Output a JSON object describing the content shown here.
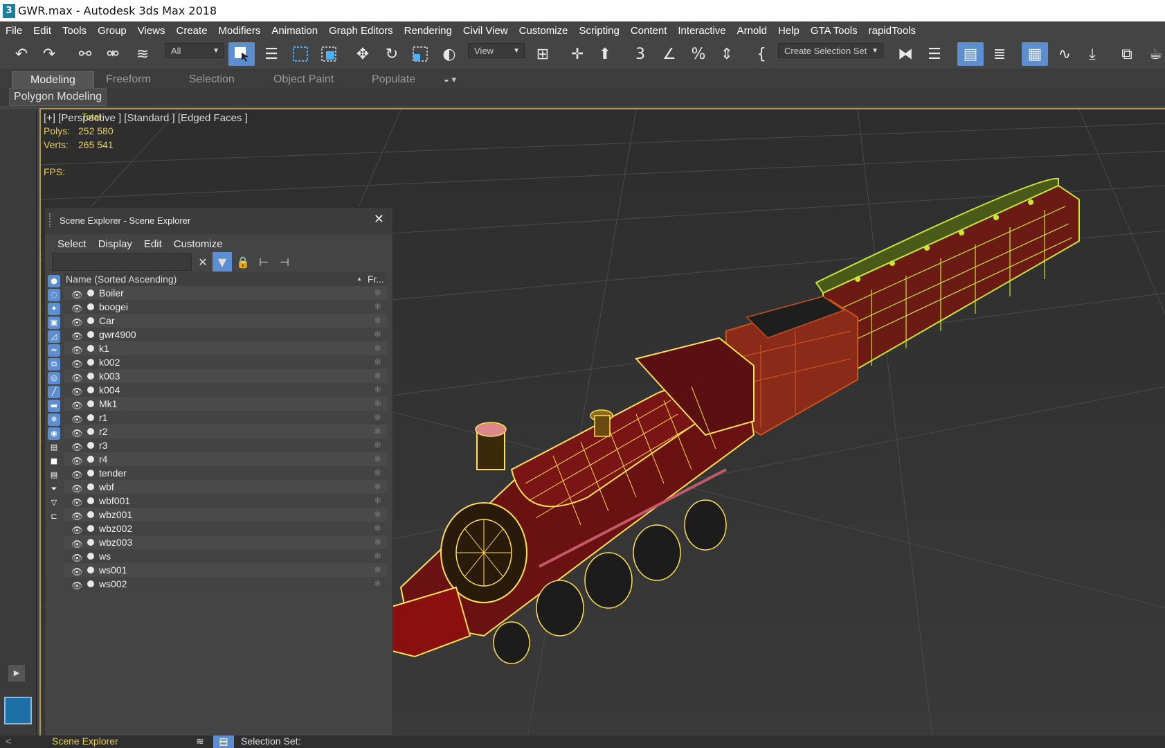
{
  "window": {
    "title": "GWR.max - Autodesk 3ds Max 2018",
    "app_icon": "3"
  },
  "menu": [
    "File",
    "Edit",
    "Tools",
    "Group",
    "Views",
    "Create",
    "Modifiers",
    "Animation",
    "Graph Editors",
    "Rendering",
    "Civil View",
    "Customize",
    "Scripting",
    "Content",
    "Interactive",
    "Arnold",
    "Help",
    "GTA Tools",
    "rapidTools"
  ],
  "toolbar": {
    "filter_value": "All",
    "refcoord_value": "View",
    "selset_value": "Create Selection Set"
  },
  "ribbon": {
    "tabs": [
      "Modeling",
      "Freeform",
      "Selection",
      "Object Paint",
      "Populate"
    ],
    "active": "Modeling",
    "panel_button": "Polygon Modeling"
  },
  "viewport": {
    "label": "[+] [Perspective ] [Standard ] [Edged Faces ]",
    "stats_total_label": "Total",
    "polys_label": "Polys:",
    "polys_value": "252 580",
    "verts_label": "Verts:",
    "verts_value": "265 541",
    "fps_label": "FPS:"
  },
  "scene_explorer": {
    "title": "Scene Explorer - Scene Explorer",
    "menu": [
      "Select",
      "Display",
      "Edit",
      "Customize"
    ],
    "col_name": "Name (Sorted Ascending)",
    "col_frozen": "Fr...",
    "objects": [
      "Boiler",
      "boogei",
      "Car",
      "gwr4900",
      "k1",
      "k002",
      "k003",
      "k004",
      "Mk1",
      "r1",
      "r2",
      "r3",
      "r4",
      "tender",
      "wbf",
      "wbf001",
      "wbz001",
      "wbz002",
      "wbz003",
      "ws",
      "ws001",
      "ws002"
    ]
  },
  "bottom": {
    "explorer_tab": "Scene Explorer",
    "selection_set_label": "Selection Set:"
  },
  "colors": {
    "accent": "#5d8fd0",
    "viewport_bg": "#3b3b3b",
    "stats_yellow": "#e6cf5a",
    "wire_yellow": "#ffe14d",
    "wire_green": "#c8e632",
    "body_red": "#7a1515"
  }
}
